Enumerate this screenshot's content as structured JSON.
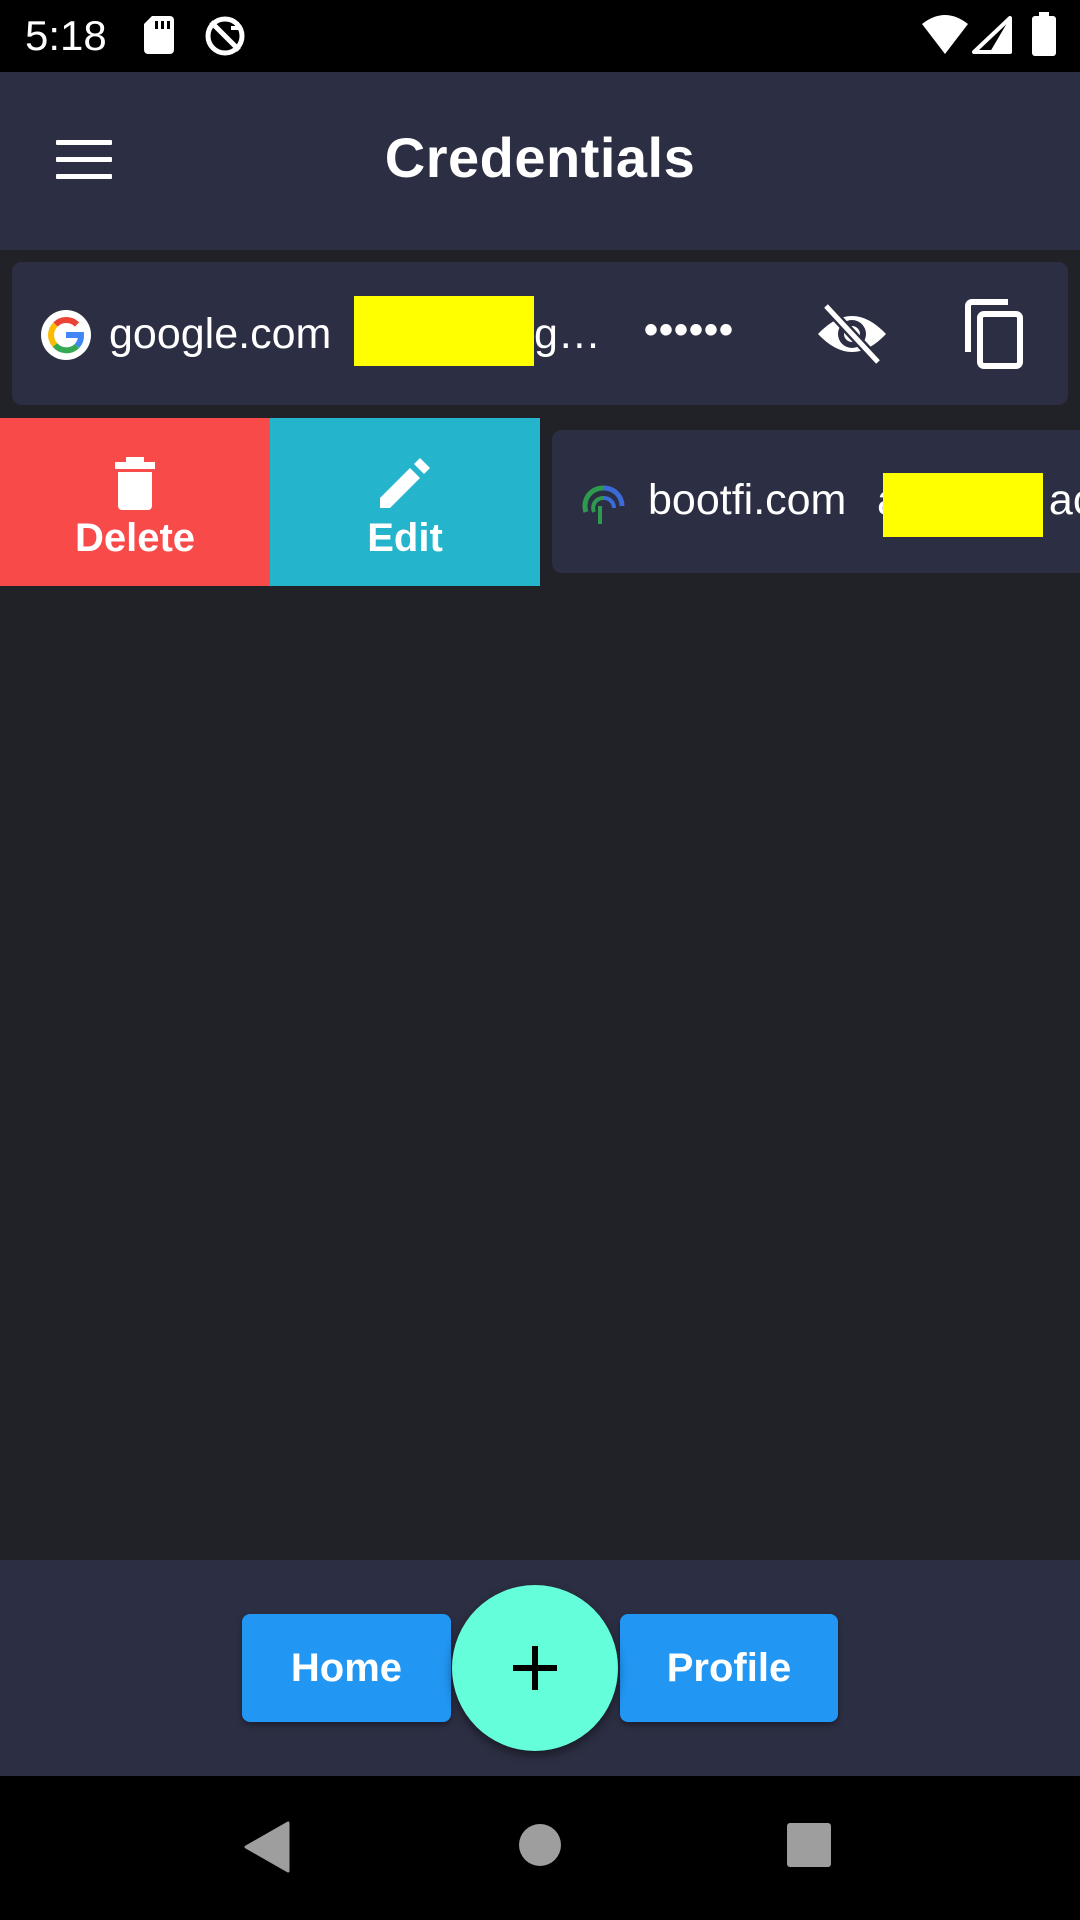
{
  "status_bar": {
    "time": "5:18",
    "icons": [
      "sd-card-icon",
      "no-sync-icon",
      "wifi-icon",
      "cell-signal-icon",
      "battery-icon"
    ]
  },
  "app_bar": {
    "title": "Credentials",
    "menu_icon": "hamburger-menu-icon"
  },
  "credentials": [
    {
      "site": "google.com",
      "icon": "google-logo-icon",
      "username_visible": "g…",
      "password_mask": "••••••",
      "actions": [
        "eye-off-icon",
        "copy-icon"
      ]
    },
    {
      "site": "bootfi.com",
      "icon": "bootfi-logo-icon",
      "username_visible_prefix": "a",
      "username_visible_suffix": "ac"
    }
  ],
  "swipe_actions": {
    "delete_label": "Delete",
    "edit_label": "Edit"
  },
  "bottom_bar": {
    "home_label": "Home",
    "profile_label": "Profile",
    "fab_icon": "plus-icon"
  },
  "colors": {
    "background": "#212228",
    "surface": "#2c2e43",
    "delete": "#f94a4a",
    "edit": "#24b4cc",
    "nav_button": "#2196f3",
    "fab": "#64ffda",
    "redaction": "#ffff00"
  }
}
